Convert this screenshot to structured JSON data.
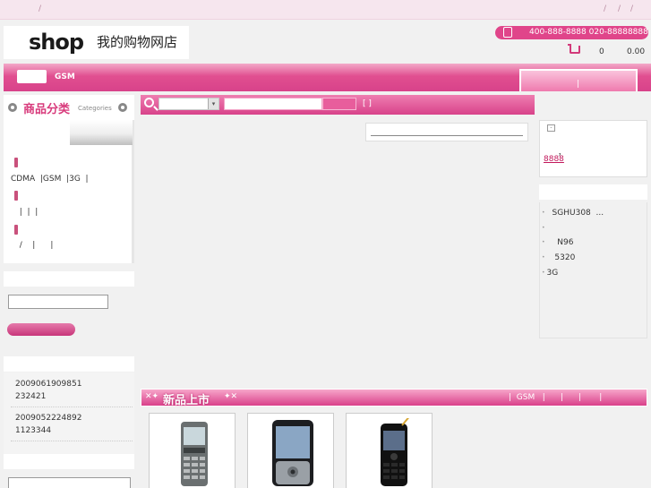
{
  "topbar": {
    "separators": [
      "/",
      "/",
      "/",
      "/"
    ]
  },
  "logo": {
    "mark": "shop",
    "store_name": "我的购物网店"
  },
  "header": {
    "phone_numbers": "400-888-8888 020-88888888"
  },
  "cart": {
    "count": "0",
    "total": "0.00"
  },
  "nav": {
    "items": [
      "",
      "GSM"
    ],
    "right_tab_label": "|"
  },
  "categories": {
    "title": "商品分类",
    "subtitle": "Categories",
    "lines": [
      "CDMA  |GSM  |3G  |",
      "  |  |  |",
      "  /    |      |"
    ]
  },
  "orders": {
    "items": [
      "2009061909851\n232421",
      "2009052224892\n1123344"
    ]
  },
  "search": {
    "select_arrow": "▾",
    "brackets": "[   ]"
  },
  "notice": {
    "icon": "-",
    "text": "，",
    "link": "8888"
  },
  "ranking": {
    "items": [
      "SGHU308  ...",
      "",
      "  N96",
      " 5320",
      "3G"
    ]
  },
  "new_products": {
    "title": "新品上市",
    "links": "|  GSM   |      |      |       |"
  },
  "products": [
    {
      "name": "nokia-e66-phone"
    },
    {
      "name": "lg-slider-phone"
    },
    {
      "name": "black-candybar-phone"
    }
  ],
  "colors": {
    "accent": "#d8428a",
    "topbar": "#f6e6ee",
    "link": "#c2185b"
  }
}
